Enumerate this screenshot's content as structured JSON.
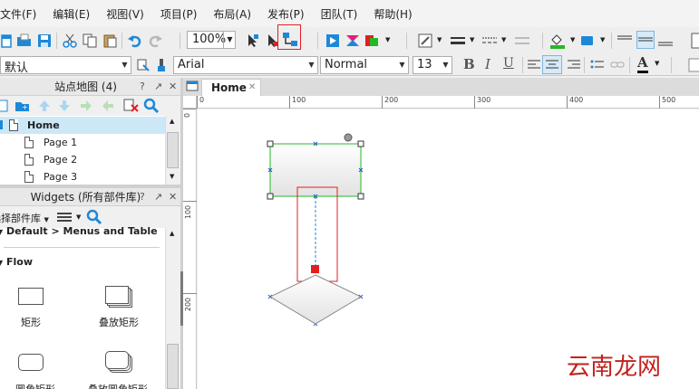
{
  "menu": [
    "文件(F)",
    "编辑(E)",
    "视图(V)",
    "项目(P)",
    "布局(A)",
    "发布(P)",
    "团队(T)",
    "帮助(H)"
  ],
  "toolbar": {
    "zoom": "100%",
    "style_value": "默认",
    "font_value": "Arial",
    "weight_value": "Normal",
    "size_value": "13",
    "bold_label": "B",
    "italic_label": "I",
    "underline_label": "U",
    "font_color_label": "A"
  },
  "colors": {
    "accent_blue": "#1e88d8",
    "selection_red": "#e02020",
    "connector_green": "#25b825",
    "tree_selected": "#cce8f7"
  },
  "sitemap": {
    "title": "站点地图 (4)",
    "items": [
      "Home",
      "Page 1",
      "Page 2",
      "Page 3"
    ]
  },
  "widgets": {
    "title": "Widgets (所有部件库)",
    "library_select": "选择部件库",
    "group_label": "Default > Menus and Table",
    "section_label": "Flow",
    "items": [
      "矩形",
      "叠放矩形",
      "圆角矩形",
      "叠放圆角矩形"
    ]
  },
  "canvas": {
    "tab_label": "Home",
    "ruler_top": [
      "0",
      "100",
      "200",
      "300",
      "400",
      "500"
    ],
    "ruler_left": [
      "0",
      "100",
      "200"
    ]
  },
  "watermark": "云南龙网"
}
